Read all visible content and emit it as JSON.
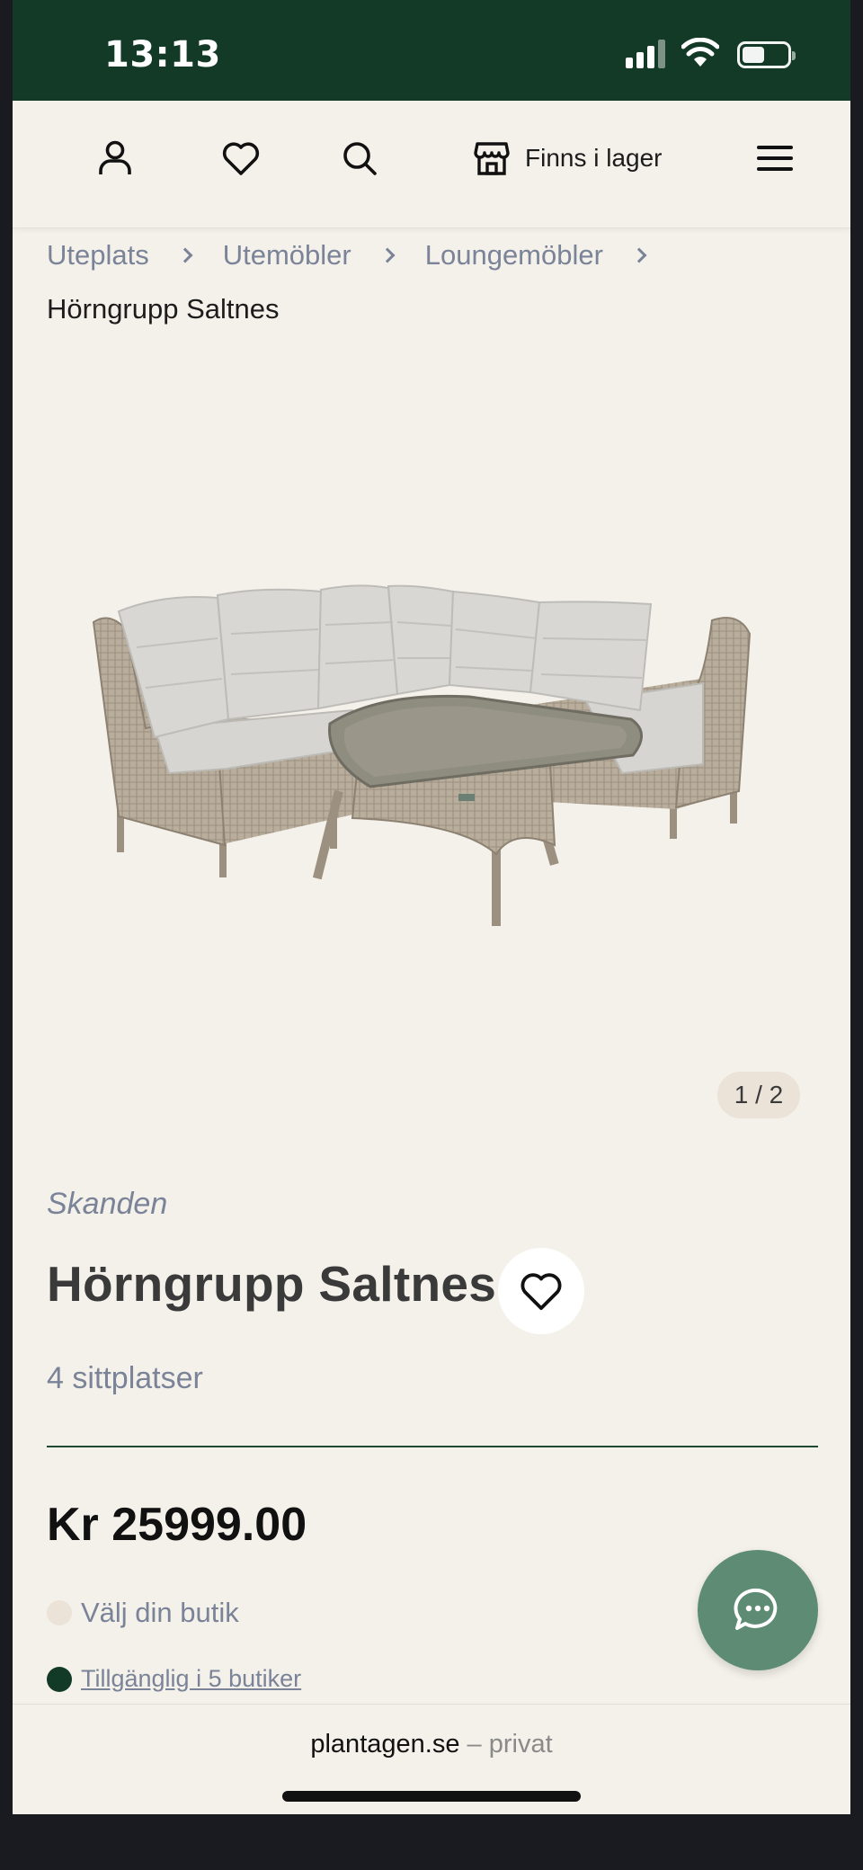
{
  "status_bar": {
    "time": "13:13"
  },
  "header": {
    "account_icon": "user-icon",
    "wishlist_icon": "heart-icon",
    "search_icon": "search-icon",
    "store_icon": "store-icon",
    "stock_label": "Finns i lager",
    "menu_icon": "hamburger-menu-icon"
  },
  "breadcrumb": {
    "items": [
      "Uteplats",
      "Utemöbler",
      "Loungemöbler"
    ],
    "current": "Hörngrupp Saltnes"
  },
  "gallery": {
    "counter": "1 / 2"
  },
  "product": {
    "brand": "Skanden",
    "title": "Hörngrupp Saltnes",
    "subtitle": "4 sittplatser",
    "price": "Kr 25999.00",
    "store_prompt": "Välj din butik",
    "availability": "Tillgänglig i 5 butiker"
  },
  "colors": {
    "brand_green": "#123a26",
    "background": "#f4f1ea",
    "chat_green": "#5d8b73",
    "muted_text": "#7a8397"
  },
  "chat": {
    "icon": "chat-bubble-icon"
  },
  "browser": {
    "domain": "plantagen.se",
    "separator": "–",
    "mode": "privat"
  }
}
